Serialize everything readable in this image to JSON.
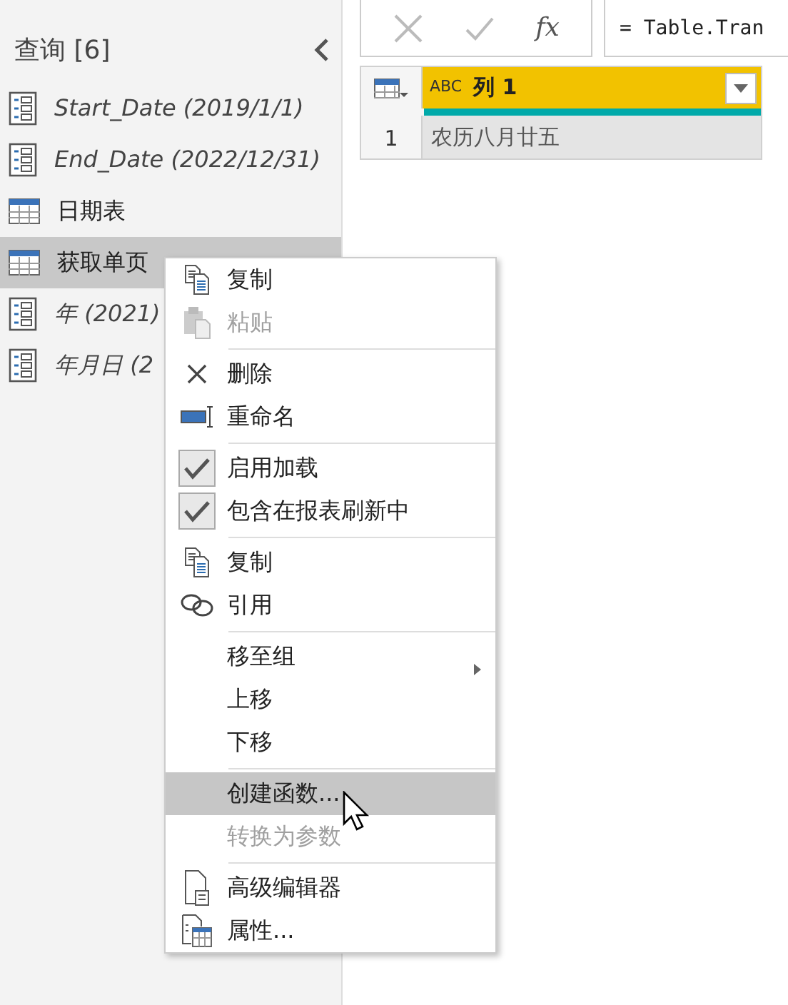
{
  "queries_pane": {
    "title": "查询 [6]",
    "items": [
      {
        "kind": "parameter",
        "label": "Start_Date (2019/1/1)",
        "selected": false
      },
      {
        "kind": "parameter",
        "label": "End_Date (2022/12/31)",
        "selected": false
      },
      {
        "kind": "table",
        "label": "日期表",
        "selected": false
      },
      {
        "kind": "table",
        "label": "获取单页",
        "selected": true
      },
      {
        "kind": "parameter",
        "label": "年 (2021)",
        "selected": false
      },
      {
        "kind": "parameter",
        "label": "年月日 (2",
        "selected": false
      }
    ]
  },
  "formula_bar": {
    "fx": "fx",
    "formula": "= Table.Tran"
  },
  "table": {
    "columns": [
      {
        "label": "列 1",
        "type_label": "ABC"
      }
    ],
    "rows": [
      {
        "index": "1",
        "cells": [
          "农历八月廿五"
        ]
      }
    ]
  },
  "context_menu": [
    {
      "kind": "item",
      "label": "复制",
      "disabled": false,
      "selected": false
    },
    {
      "kind": "item",
      "label": "粘贴",
      "disabled": true,
      "selected": false
    },
    {
      "kind": "separator"
    },
    {
      "kind": "item",
      "label": "删除",
      "disabled": false,
      "selected": false
    },
    {
      "kind": "item",
      "label": "重命名",
      "disabled": false,
      "selected": false
    },
    {
      "kind": "separator"
    },
    {
      "kind": "check",
      "label": "启用加载",
      "checked": true,
      "disabled": false,
      "selected": false
    },
    {
      "kind": "check",
      "label": "包含在报表刷新中",
      "checked": true,
      "disabled": false,
      "selected": false
    },
    {
      "kind": "separator"
    },
    {
      "kind": "item",
      "label": "复制",
      "disabled": false,
      "selected": false
    },
    {
      "kind": "item",
      "label": "引用",
      "disabled": false,
      "selected": false
    },
    {
      "kind": "separator"
    },
    {
      "kind": "submenu",
      "label": "移至组",
      "disabled": false,
      "selected": false
    },
    {
      "kind": "item",
      "label": "上移",
      "disabled": false,
      "selected": false
    },
    {
      "kind": "item",
      "label": "下移",
      "disabled": false,
      "selected": false
    },
    {
      "kind": "separator"
    },
    {
      "kind": "item",
      "label": "创建函数...",
      "disabled": false,
      "selected": true
    },
    {
      "kind": "item",
      "label": "转换为参数",
      "disabled": true,
      "selected": false
    },
    {
      "kind": "separator"
    },
    {
      "kind": "item",
      "label": "高级编辑器",
      "disabled": false,
      "selected": false
    },
    {
      "kind": "item",
      "label": "属性...",
      "disabled": false,
      "selected": false
    }
  ]
}
